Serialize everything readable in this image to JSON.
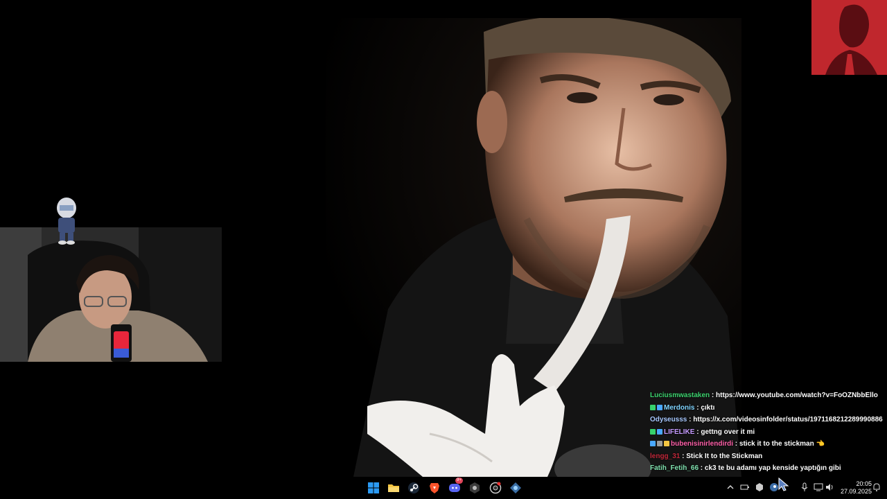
{
  "chat": {
    "messages": [
      {
        "user": "Luciusmwastaken",
        "color": "#3cd26e",
        "badges": [],
        "text": "https://www.youtube.com/watch?v=FoOZNbbEllo"
      },
      {
        "user": "Merdonis",
        "color": "#7fd4ff",
        "badges": [
          "#37d16c",
          "#4aa8ff"
        ],
        "text": "çıktı"
      },
      {
        "user": "Odyseusss",
        "color": "#a8c8ff",
        "badges": [],
        "text": "https://x.com/videosinfolder/status/1971168212289990886"
      },
      {
        "user": "LIFELIKE",
        "color": "#c59bff",
        "badges": [
          "#37d16c",
          "#4aa8ff"
        ],
        "text": "gettng over it mi"
      },
      {
        "user": "bubenisinirlendirdi",
        "color": "#ff5fa8",
        "badges": [
          "#4aa8ff",
          "#9b9b9b",
          "#f4c542"
        ],
        "text": "stick it to the stickman 👈"
      },
      {
        "user": "lengg_31",
        "color": "#c1283a",
        "badges": [],
        "text": "Stick It to the Stickman"
      },
      {
        "user": "Fatih_Fetih_66",
        "color": "#7fe0ae",
        "badges": [],
        "text": "ck3 te bu adamı yap kenside yaptığın gibi"
      }
    ]
  },
  "taskbar": {
    "apps": [
      {
        "name": "start-icon",
        "color": "#2b9af3"
      },
      {
        "name": "file-explorer-icon",
        "color": "#f4c542"
      },
      {
        "name": "steam-icon",
        "color": "#1b2838"
      },
      {
        "name": "brave-browser-icon",
        "color": "#fb542b"
      },
      {
        "name": "discord-icon",
        "color": "#5865f2"
      },
      {
        "name": "obs-icon",
        "color": "#3c3c3c"
      },
      {
        "name": "chrome-icon",
        "color": "#e33"
      },
      {
        "name": "extension-icon",
        "color": "#3a6ea5"
      }
    ],
    "discord_badge": "9+"
  },
  "clock": {
    "time": "20:05",
    "date": "27.09.2025"
  }
}
